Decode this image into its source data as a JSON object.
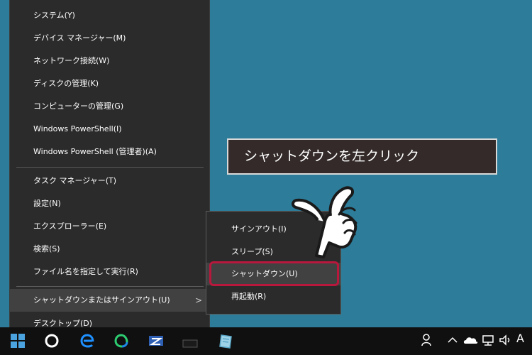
{
  "winx_menu": {
    "items": [
      {
        "label": "システム(Y)"
      },
      {
        "label": "デバイス マネージャー(M)"
      },
      {
        "label": "ネットワーク接続(W)"
      },
      {
        "label": "ディスクの管理(K)"
      },
      {
        "label": "コンピューターの管理(G)"
      },
      {
        "label": "Windows PowerShell(I)"
      },
      {
        "label": "Windows PowerShell (管理者)(A)"
      },
      {
        "label": "タスク マネージャー(T)"
      },
      {
        "label": "設定(N)"
      },
      {
        "label": "エクスプローラー(E)"
      },
      {
        "label": "検索(S)"
      },
      {
        "label": "ファイル名を指定して実行(R)"
      },
      {
        "label": "シャットダウンまたはサインアウト(U)"
      },
      {
        "label": "デスクトップ(D)"
      }
    ],
    "submenu_arrow": ">"
  },
  "submenu": {
    "items": [
      {
        "label": "サインアウト(I)"
      },
      {
        "label": "スリープ(S)"
      },
      {
        "label": "シャットダウン(U)"
      },
      {
        "label": "再起動(R)"
      }
    ]
  },
  "callout": {
    "text": "シャットダウンを左クリック"
  },
  "taskbar": {
    "ime_indicator": "A",
    "tray_chevron": "^"
  },
  "colors": {
    "desktop": "#2d7d9a",
    "menu_bg": "#2b2b2b",
    "highlight": "#b8183c",
    "callout_bg": "#332a29"
  }
}
